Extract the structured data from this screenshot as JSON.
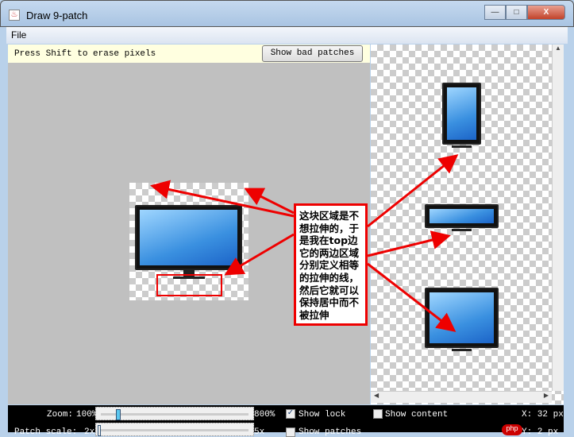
{
  "window": {
    "title": "Draw 9-patch",
    "minimize": "—",
    "maximize": "□",
    "close": "X"
  },
  "menu": {
    "file": "File"
  },
  "editor": {
    "hint": "Press Shift to erase pixels",
    "bad_patches_button": "Show bad patches"
  },
  "annotation": "这块区域是不想拉伸的，于是我在top边它的两边区域分别定义相等的拉伸的线，然后它就可以保持居中而不被拉伸",
  "bottom": {
    "zoom_label": "Zoom:",
    "zoom_min": "100%",
    "zoom_max": "800%",
    "zoom_value_fraction": 0.05,
    "patch_scale_label": "Patch scale:",
    "patch_min": "2x",
    "patch_max": "5x",
    "patch_value_fraction": 0.0,
    "show_lock": "Show lock",
    "show_lock_checked": true,
    "show_content": "Show content",
    "show_content_checked": false,
    "show_patches": "Show patches",
    "show_patches_checked": false,
    "x_readout": "X: 32 px",
    "y_readout": "Y: 2 px"
  },
  "watermark": "php"
}
